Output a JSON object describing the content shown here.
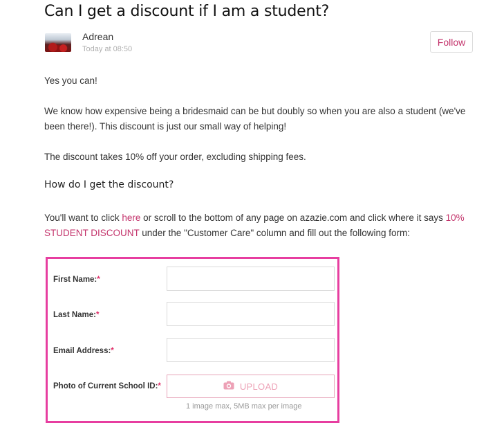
{
  "article": {
    "title": "Can I get a discount if I am a student?",
    "author": "Adrean",
    "timestamp": "Today at 08:50",
    "follow_label": "Follow",
    "p1": "Yes you can!",
    "p2": "We know how expensive being a bridesmaid can be but doubly so when you are also a student (we've been there!). This discount is just our small way of helping!",
    "p3": "The discount takes 10% off your order, excluding shipping fees.",
    "heading": "How do I get the discount?",
    "p4_a": "You'll want to click ",
    "p4_link1": "here",
    "p4_b": " or scroll to the bottom of any page on azazie.com and click where it says ",
    "p4_link2": "10% STUDENT DISCOUNT",
    "p4_c": " under the \"Customer Care\" column and fill out the following form:"
  },
  "form": {
    "first_name_label": "First Name:",
    "last_name_label": "Last Name:",
    "email_label": "Email Address:",
    "photo_label": "Photo of Current School ID:",
    "required_mark": "*",
    "upload_label": "UPLOAD",
    "upload_hint": "1 image max, 5MB max per image",
    "border_color": "#e73ea0"
  },
  "colors": {
    "accent": "#c3336b"
  }
}
